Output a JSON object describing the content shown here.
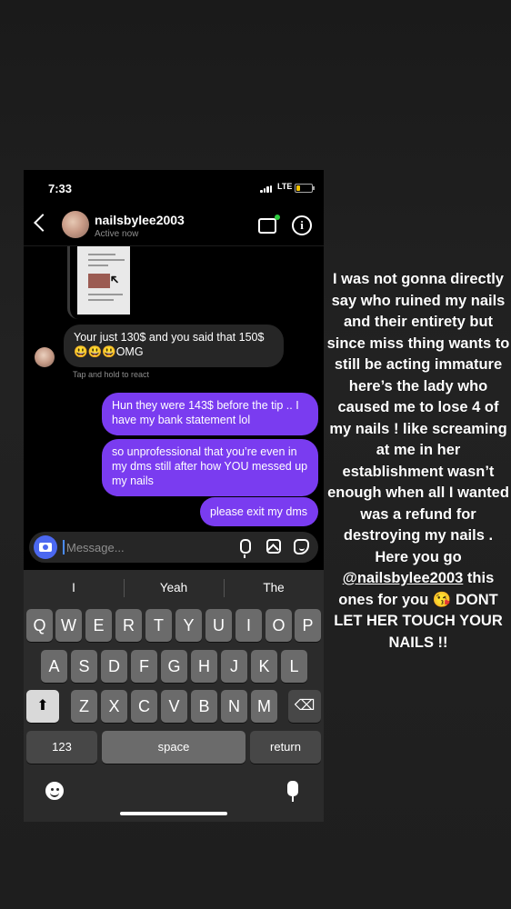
{
  "status_bar": {
    "time": "7:33",
    "network": "LTE"
  },
  "header": {
    "username": "nailsbylee2003",
    "status": "Active now"
  },
  "messages": [
    {
      "from": "them",
      "text": "Your just 130$ and you said that 150$ 😃😃😃OMG"
    },
    {
      "from": "me",
      "text": "Hun they were 143$ before the tip .. I have my bank statement lol"
    },
    {
      "from": "me",
      "text": "so unprofessional that you’re even in my dms still after how YOU messed up my nails"
    },
    {
      "from": "me",
      "text": "please exit my dms"
    }
  ],
  "react_hint": "Tap and hold to react",
  "composer": {
    "placeholder": "Message..."
  },
  "keyboard": {
    "suggestions": [
      "I",
      "Yeah",
      "The"
    ],
    "row1": [
      "Q",
      "W",
      "E",
      "R",
      "T",
      "Y",
      "U",
      "I",
      "O",
      "P"
    ],
    "row2": [
      "A",
      "S",
      "D",
      "F",
      "G",
      "H",
      "J",
      "K",
      "L"
    ],
    "row3": [
      "Z",
      "X",
      "C",
      "V",
      "B",
      "N",
      "M"
    ],
    "numbers_label": "123",
    "space_label": "space",
    "return_label": "return"
  },
  "caption": {
    "part1": "I was not gonna directly say who ruined my nails and their entirety but since miss thing wants to still be acting immature here’s the lady who caused me to lose 4 of my nails ! like screaming at me in her establishment wasn’t enough when all I wanted was a refund for destroying my nails . Here you go ",
    "mention": "@nailsbylee2003",
    "part2": " this ones for you 😘 DONT LET HER TOUCH YOUR NAILS !!"
  }
}
